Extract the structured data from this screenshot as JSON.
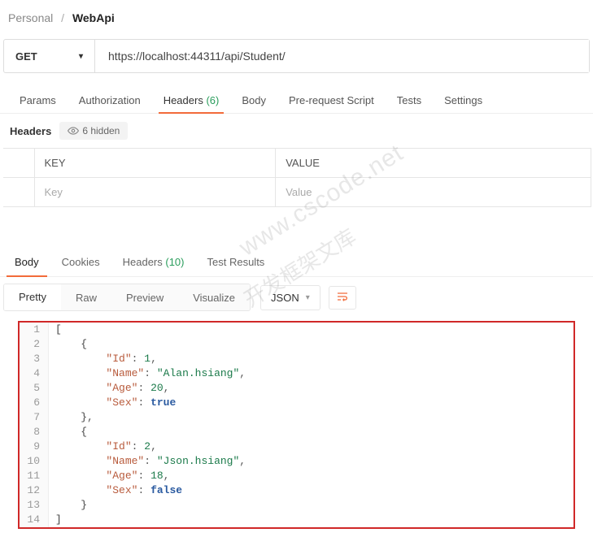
{
  "breadcrumb": {
    "root": "Personal",
    "current": "WebApi"
  },
  "request": {
    "method": "GET",
    "url": "https://localhost:44311/api/Student/"
  },
  "reqTabs": {
    "params": "Params",
    "auth": "Authorization",
    "headers": "Headers",
    "headersCount": "(6)",
    "body": "Body",
    "prereq": "Pre-request Script",
    "tests": "Tests",
    "settings": "Settings"
  },
  "headersSub": {
    "label": "Headers",
    "hidden": "6 hidden"
  },
  "kv": {
    "keyHeader": "KEY",
    "valueHeader": "VALUE",
    "keyPlaceholder": "Key",
    "valuePlaceholder": "Value"
  },
  "respTabs": {
    "body": "Body",
    "cookies": "Cookies",
    "headers": "Headers",
    "headersCount": "(10)",
    "tests": "Test Results"
  },
  "views": {
    "pretty": "Pretty",
    "raw": "Raw",
    "preview": "Preview",
    "visualize": "Visualize",
    "format": "JSON"
  },
  "code": [
    {
      "n": "1",
      "html": "<span class='tok-bracket'>[</span>"
    },
    {
      "n": "2",
      "html": "    <span class='tok-bracket'>{</span>"
    },
    {
      "n": "3",
      "html": "        <span class='tok-key'>\"Id\"</span><span class='tok-punc'>:</span> <span class='tok-num'>1</span><span class='tok-punc'>,</span>"
    },
    {
      "n": "4",
      "html": "        <span class='tok-key'>\"Name\"</span><span class='tok-punc'>:</span> <span class='tok-str'>\"Alan.hsiang\"</span><span class='tok-punc'>,</span>"
    },
    {
      "n": "5",
      "html": "        <span class='tok-key'>\"Age\"</span><span class='tok-punc'>:</span> <span class='tok-num'>20</span><span class='tok-punc'>,</span>"
    },
    {
      "n": "6",
      "html": "        <span class='tok-key'>\"Sex\"</span><span class='tok-punc'>:</span> <span class='tok-bool'>true</span>"
    },
    {
      "n": "7",
      "html": "    <span class='tok-bracket'>}</span><span class='tok-punc'>,</span>"
    },
    {
      "n": "8",
      "html": "    <span class='tok-bracket'>{</span>"
    },
    {
      "n": "9",
      "html": "        <span class='tok-key'>\"Id\"</span><span class='tok-punc'>:</span> <span class='tok-num'>2</span><span class='tok-punc'>,</span>"
    },
    {
      "n": "10",
      "html": "        <span class='tok-key'>\"Name\"</span><span class='tok-punc'>:</span> <span class='tok-str'>\"Json.hsiang\"</span><span class='tok-punc'>,</span>"
    },
    {
      "n": "11",
      "html": "        <span class='tok-key'>\"Age\"</span><span class='tok-punc'>:</span> <span class='tok-num'>18</span><span class='tok-punc'>,</span>"
    },
    {
      "n": "12",
      "html": "        <span class='tok-key'>\"Sex\"</span><span class='tok-punc'>:</span> <span class='tok-bool'>false</span>"
    },
    {
      "n": "13",
      "html": "    <span class='tok-bracket'>}</span>"
    },
    {
      "n": "14",
      "html": "<span class='tok-bracket'>]</span>"
    }
  ],
  "watermark": {
    "line1": "www.cscode.net",
    "line2": "开发框架文库"
  }
}
